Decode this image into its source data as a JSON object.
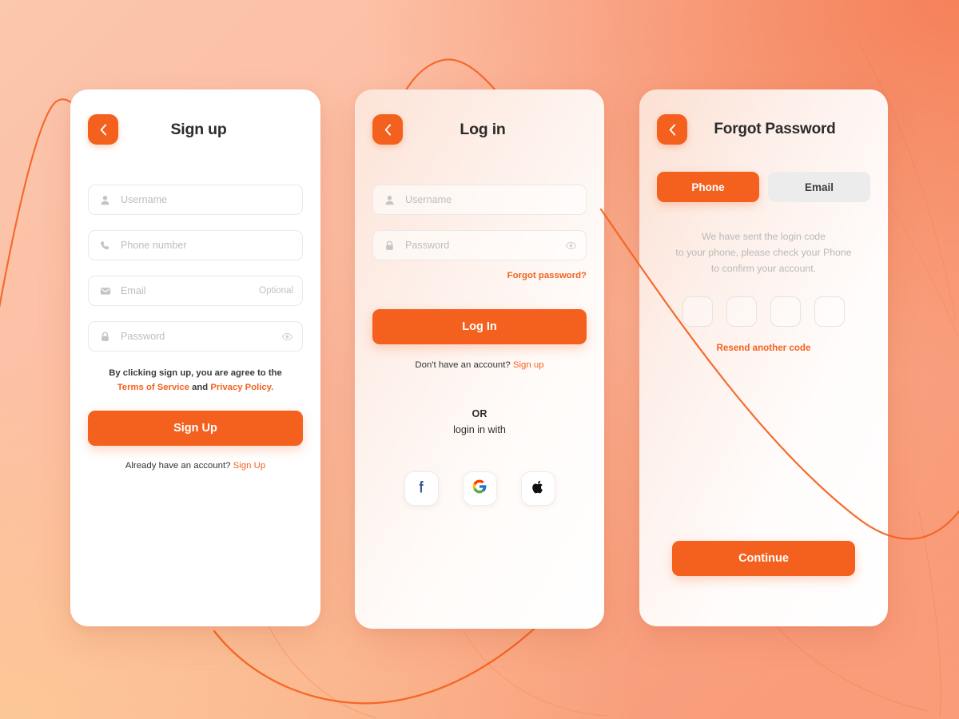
{
  "theme": {
    "accent": "#F4611F",
    "bg_top_left": "#FBC7AD",
    "bg_top_right": "#F5865E",
    "bg_bottom_left": "#FBC59A",
    "bg_bottom_right": "#F8A17F",
    "placeholder_gray": "#BDBDBD",
    "segment_idle_bg": "#ECECEC"
  },
  "screens": {
    "signup": {
      "title": "Sign up",
      "back_icon": "chevron-left-icon",
      "fields": [
        {
          "icon": "user-icon",
          "placeholder": "Username",
          "trailing": ""
        },
        {
          "icon": "phone-icon",
          "placeholder": "Phone number",
          "trailing": ""
        },
        {
          "icon": "mail-icon",
          "placeholder": "Email",
          "trailing": "Optional"
        },
        {
          "icon": "lock-icon",
          "placeholder": "Password",
          "trailing": "eye-icon"
        }
      ],
      "legal_prefix": "By clicking sign up, you are agree to the",
      "legal_terms": "Terms of Service",
      "legal_and": " and ",
      "legal_privacy": "Privacy Policy.",
      "submit_label": "Sign Up",
      "footer_text": "Already  have an account? ",
      "footer_link": "Sign Up"
    },
    "login": {
      "title": "Log in",
      "back_icon": "chevron-left-icon",
      "fields": [
        {
          "icon": "user-icon",
          "placeholder": "Username",
          "trailing": ""
        },
        {
          "icon": "lock-icon",
          "placeholder": "Password",
          "trailing": "eye-icon"
        }
      ],
      "forgot_link": "Forgot password?",
      "submit_label": "Log In",
      "footer_text": "Don't  have an account? ",
      "footer_link": "Sign up",
      "divider_word": "OR",
      "divider_sub": "login in with",
      "socials": [
        {
          "name": "facebook-icon",
          "label": "f"
        },
        {
          "name": "google-icon",
          "label": "G"
        },
        {
          "name": "apple-icon",
          "label": "apple"
        }
      ]
    },
    "forgot": {
      "title": "Forgot Password",
      "back_icon": "chevron-left-icon",
      "tabs": [
        {
          "label": "Phone",
          "active": true
        },
        {
          "label": "Email",
          "active": false
        }
      ],
      "message_lines": [
        "We have sent the login code",
        "to your phone, please check your Phone",
        "to confirm your account."
      ],
      "otp_boxes": 4,
      "otp_values": [
        "",
        "",
        "",
        ""
      ],
      "resend_label": "Resend another code",
      "submit_label": "Continue"
    }
  }
}
